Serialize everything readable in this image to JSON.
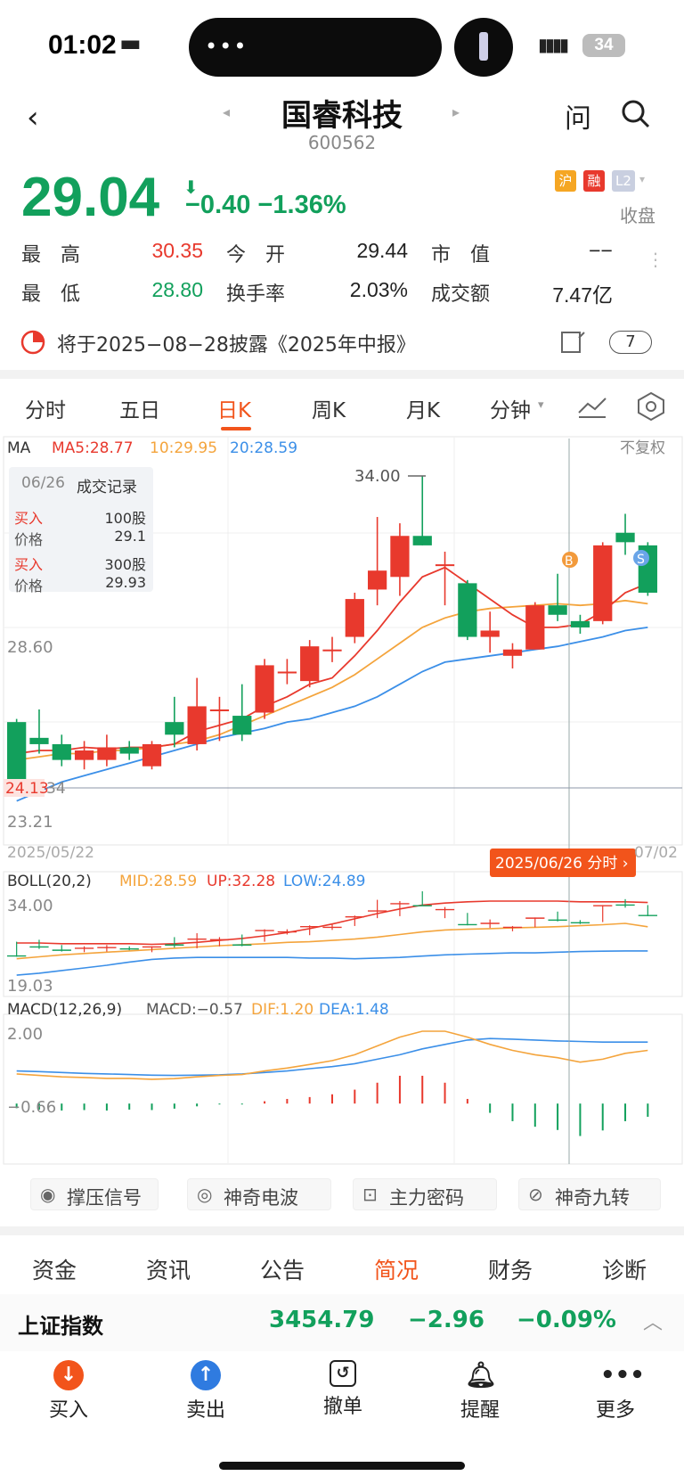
{
  "status": {
    "time": "01:02",
    "battery": "34"
  },
  "header": {
    "title": "国睿科技",
    "code": "600562",
    "ask_label": "问"
  },
  "quote": {
    "price": "29.04",
    "change": "−0.40",
    "change_pct": "−1.36%",
    "badge_sh": "沪",
    "badge_rong": "融",
    "badge_l2": "L2",
    "status": "收盘"
  },
  "stats": {
    "high_label": "最　高",
    "high": "30.35",
    "open_label": "今　开",
    "open": "29.44",
    "mcap_label": "市　值",
    "mcap": "−−",
    "low_label": "最　低",
    "low": "28.80",
    "turnover_label": "换手率",
    "turnover": "2.03%",
    "amount_label": "成交额",
    "amount": "7.47亿"
  },
  "notice": {
    "text": "将于2025−08−28披露《2025年中报》",
    "count": "7"
  },
  "tabs": [
    "分时",
    "五日",
    "日K",
    "周K",
    "月K",
    "分钟"
  ],
  "active_tab": "日K",
  "chart_labels": {
    "ma_title": "MA",
    "ma5": "MA5:28.77",
    "ma10": "10:29.95",
    "ma20": "20:28.59",
    "adjust": "不复权",
    "max_price": "34.00",
    "mid_price": "28.60",
    "last_price": "24.13",
    "last_price_suffix": "34",
    "min_price": "23.21",
    "date_start": "2025/05/22",
    "date_end": "07/02",
    "cursor_date": "2025/06/26 分时 ›",
    "boll_title": "BOLL(20,2)",
    "boll_mid": "MID:28.59",
    "boll_up": "UP:32.28",
    "boll_low": "LOW:24.89",
    "boll_top": "34.00",
    "boll_bottom": "19.03",
    "macd_title": "MACD(12,26,9)",
    "macd": "MACD:−0.57",
    "dif": "DIF:1.20",
    "dea": "DEA:1.48",
    "macd_top": "2.00",
    "macd_bottom": "−0.66",
    "marker_b": "B",
    "marker_s": "S"
  },
  "trade_record": {
    "date": "06/26",
    "title": "成交记录",
    "rows": [
      {
        "side": "买入",
        "qty": "100股",
        "price_label": "价格",
        "price": "29.1"
      },
      {
        "side": "买入",
        "qty": "300股",
        "price_label": "价格",
        "price": "29.93"
      }
    ]
  },
  "tools": [
    "撑压信号",
    "神奇电波",
    "主力密码",
    "神奇九转"
  ],
  "fundamental_tabs": [
    "资金",
    "资讯",
    "公告",
    "简况",
    "财务",
    "诊断"
  ],
  "active_fundamental": "简况",
  "index": {
    "name": "上证指数",
    "value": "3454.79",
    "change": "−2.96",
    "pct": "−0.09%"
  },
  "bottom_nav": [
    "买入",
    "卖出",
    "撤单",
    "提醒",
    "更多"
  ],
  "colors": {
    "up": "#e8392d",
    "down": "#12a05c",
    "ma5": "#e8392d",
    "ma10": "#f4a43c",
    "ma20": "#3b8fe8",
    "accent": "#f2541b"
  },
  "chart_data": {
    "type": "candlestick",
    "candles": [
      {
        "o": 26.2,
        "c": 24.13,
        "h": 26.3,
        "l": 24.0
      },
      {
        "o": 25.7,
        "c": 25.5,
        "h": 26.6,
        "l": 25.2
      },
      {
        "o": 25.5,
        "c": 25.0,
        "h": 25.8,
        "l": 24.8
      },
      {
        "o": 25.0,
        "c": 25.3,
        "h": 25.6,
        "l": 24.7
      },
      {
        "o": 25.0,
        "c": 25.4,
        "h": 25.8,
        "l": 24.8
      },
      {
        "o": 25.4,
        "c": 25.2,
        "h": 25.6,
        "l": 25.0
      },
      {
        "o": 24.8,
        "c": 25.5,
        "h": 25.6,
        "l": 24.7
      },
      {
        "o": 26.2,
        "c": 25.8,
        "h": 27.0,
        "l": 25.4
      },
      {
        "o": 25.5,
        "c": 26.7,
        "h": 27.6,
        "l": 25.3
      },
      {
        "o": 26.6,
        "c": 26.6,
        "h": 27.0,
        "l": 25.6
      },
      {
        "o": 26.4,
        "c": 25.8,
        "h": 27.4,
        "l": 25.6
      },
      {
        "o": 26.5,
        "c": 28.0,
        "h": 28.2,
        "l": 26.3
      },
      {
        "o": 27.8,
        "c": 27.8,
        "h": 28.2,
        "l": 27.4
      },
      {
        "o": 27.5,
        "c": 28.6,
        "h": 28.8,
        "l": 27.3
      },
      {
        "o": 28.5,
        "c": 28.5,
        "h": 28.9,
        "l": 28.1
      },
      {
        "o": 28.9,
        "c": 30.1,
        "h": 30.3,
        "l": 28.7
      },
      {
        "o": 30.4,
        "c": 31.0,
        "h": 32.7,
        "l": 29.9
      },
      {
        "o": 30.8,
        "c": 32.1,
        "h": 32.5,
        "l": 30.2
      },
      {
        "o": 32.1,
        "c": 31.8,
        "h": 34.0,
        "l": 31.8
      },
      {
        "o": 31.2,
        "c": 31.2,
        "h": 31.6,
        "l": 29.9
      },
      {
        "o": 30.6,
        "c": 28.9,
        "h": 30.7,
        "l": 28.8
      },
      {
        "o": 28.9,
        "c": 29.1,
        "h": 29.7,
        "l": 28.4
      },
      {
        "o": 28.3,
        "c": 28.5,
        "h": 28.7,
        "l": 27.9
      },
      {
        "o": 28.5,
        "c": 29.9,
        "h": 30.0,
        "l": 28.5
      },
      {
        "o": 29.9,
        "c": 29.6,
        "h": 30.9,
        "l": 29.4
      },
      {
        "o": 29.4,
        "c": 29.2,
        "h": 29.6,
        "l": 29.0
      },
      {
        "o": 29.4,
        "c": 31.8,
        "h": 31.9,
        "l": 29.3
      },
      {
        "o": 32.2,
        "c": 31.9,
        "h": 32.8,
        "l": 31.5
      },
      {
        "o": 31.8,
        "c": 30.3,
        "h": 31.9,
        "l": 30.2
      }
    ],
    "ma5": [
      25.2,
      25.3,
      25.3,
      25.4,
      25.35,
      25.4,
      25.4,
      25.5,
      25.9,
      26.1,
      26.3,
      26.7,
      27.0,
      27.4,
      27.6,
      28.3,
      29.1,
      30.0,
      30.8,
      31.1,
      30.6,
      30.1,
      29.6,
      29.2,
      29.2,
      29.3,
      29.7,
      30.3,
      30.6
    ],
    "ma10": [
      25.0,
      25.1,
      25.2,
      25.2,
      25.3,
      25.3,
      25.4,
      25.5,
      25.6,
      25.8,
      26.1,
      26.4,
      26.7,
      27.0,
      27.3,
      27.7,
      28.2,
      28.7,
      29.2,
      29.5,
      29.7,
      29.8,
      29.85,
      29.9,
      29.95,
      29.9,
      29.95,
      30.05,
      29.95
    ],
    "ma20": [
      23.7,
      24.0,
      24.3,
      24.5,
      24.7,
      24.9,
      25.1,
      25.3,
      25.5,
      25.7,
      25.85,
      26.0,
      26.2,
      26.3,
      26.5,
      26.7,
      27.0,
      27.4,
      27.8,
      28.1,
      28.2,
      28.3,
      28.4,
      28.5,
      28.6,
      28.75,
      28.9,
      29.1,
      29.2
    ],
    "price_range": [
      23.21,
      34.0
    ],
    "boll_up": [
      26.1,
      26.1,
      26.0,
      26.0,
      26.0,
      26.0,
      25.9,
      26.0,
      26.2,
      26.5,
      26.8,
      27.2,
      27.7,
      28.3,
      29.0,
      29.8,
      30.6,
      31.3,
      31.9,
      32.2,
      32.4,
      32.5,
      32.5,
      32.5,
      32.5,
      32.4,
      32.4,
      32.4,
      32.28
    ],
    "boll_mid": [
      23.7,
      24.0,
      24.3,
      24.5,
      24.7,
      24.9,
      25.1,
      25.3,
      25.5,
      25.7,
      25.85,
      26.0,
      26.2,
      26.3,
      26.5,
      26.7,
      27.0,
      27.4,
      27.8,
      28.1,
      28.2,
      28.3,
      28.4,
      28.5,
      28.6,
      28.75,
      28.9,
      29.1,
      28.59
    ],
    "boll_low": [
      21.2,
      21.5,
      21.9,
      22.3,
      22.7,
      23.2,
      23.6,
      23.8,
      23.9,
      23.9,
      23.9,
      23.9,
      23.9,
      23.8,
      23.8,
      23.7,
      23.8,
      23.9,
      24.1,
      24.3,
      24.4,
      24.5,
      24.6,
      24.6,
      24.7,
      24.8,
      24.85,
      24.9,
      24.89
    ],
    "boll_range": [
      19.03,
      34.0
    ],
    "dif": [
      0.4,
      0.35,
      0.3,
      0.28,
      0.25,
      0.25,
      0.22,
      0.24,
      0.3,
      0.35,
      0.38,
      0.5,
      0.6,
      0.72,
      0.85,
      1.05,
      1.35,
      1.65,
      1.85,
      1.85,
      1.65,
      1.4,
      1.2,
      1.05,
      0.95,
      0.8,
      0.9,
      1.1,
      1.2
    ],
    "dea": [
      0.5,
      0.48,
      0.45,
      0.42,
      0.4,
      0.38,
      0.36,
      0.35,
      0.36,
      0.37,
      0.4,
      0.45,
      0.5,
      0.58,
      0.65,
      0.75,
      0.9,
      1.05,
      1.25,
      1.4,
      1.55,
      1.6,
      1.58,
      1.55,
      1.52,
      1.5,
      1.48,
      1.48,
      1.48
    ],
    "macd": [
      -0.2,
      -0.26,
      -0.3,
      -0.28,
      -0.3,
      -0.26,
      -0.28,
      -0.22,
      -0.12,
      -0.04,
      -0.04,
      0.1,
      0.2,
      0.28,
      0.4,
      0.6,
      0.9,
      1.2,
      1.2,
      0.9,
      0.2,
      -0.4,
      -0.76,
      -1.0,
      -1.14,
      -1.4,
      -1.16,
      -0.76,
      -0.57
    ],
    "macd_range": [
      -0.66,
      2.0
    ]
  }
}
